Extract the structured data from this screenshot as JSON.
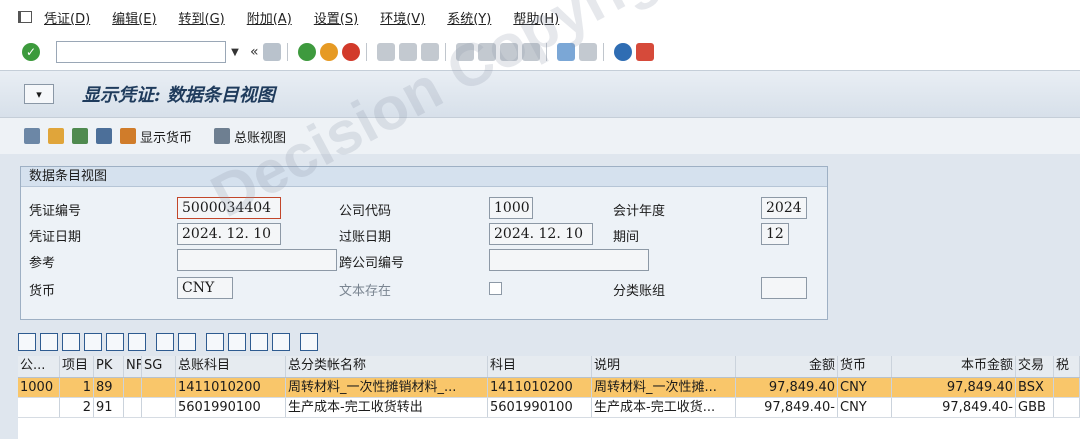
{
  "menu": [
    "凭证(D)",
    "编辑(E)",
    "转到(G)",
    "附加(A)",
    "设置(S)",
    "环境(V)",
    "系统(Y)",
    "帮助(H)"
  ],
  "toolbar": {
    "command_value": "",
    "nav_back": "«"
  },
  "title": "显示凭证: 数据条目视图",
  "app_toolbar": {
    "display_currency": "显示货币",
    "gl_view": "总账视图"
  },
  "group": {
    "title": "数据条目视图",
    "doc_no_label": "凭证编号",
    "doc_no": "5000034404",
    "company_label": "公司代码",
    "company": "1000",
    "fiscal_year_label": "会计年度",
    "fiscal_year": "2024",
    "doc_date_label": "凭证日期",
    "doc_date": "2024. 12. 10",
    "post_date_label": "过账日期",
    "post_date": "2024. 12. 10",
    "period_label": "期间",
    "period": "12",
    "ref_label": "参考",
    "ref": "",
    "cross_company_label": "跨公司编号",
    "cross_company": "",
    "currency_label": "货币",
    "currency": "CNY",
    "text_exists_label": "文本存在",
    "ledger_group_label": "分类账组",
    "ledger_group": ""
  },
  "table": {
    "headers": [
      "公...",
      "项目",
      "PK",
      "NF",
      "SG",
      "总账科目",
      "总分类帐名称",
      "科目",
      "说明",
      "金额",
      "货币",
      "本币金额",
      "交易",
      "税"
    ],
    "rows": [
      [
        "1000",
        "1",
        "89",
        "",
        "",
        "1411010200",
        "周转材料_一次性摊销材料_...",
        "1411010200",
        "周转材料_一次性摊...",
        "97,849.40",
        "CNY",
        "97,849.40",
        "BSX",
        ""
      ],
      [
        "",
        "2",
        "91",
        "",
        "",
        "5601990100",
        "生产成本-完工收货转出",
        "5601990100",
        "生产成本-完工收货...",
        "97,849.40-",
        "CNY",
        "97,849.40-",
        "GBB",
        ""
      ]
    ]
  },
  "watermark": "Decision Copyright",
  "colors": {
    "selected_row": "#f9c66a",
    "title_text": "#1f3b5c"
  }
}
